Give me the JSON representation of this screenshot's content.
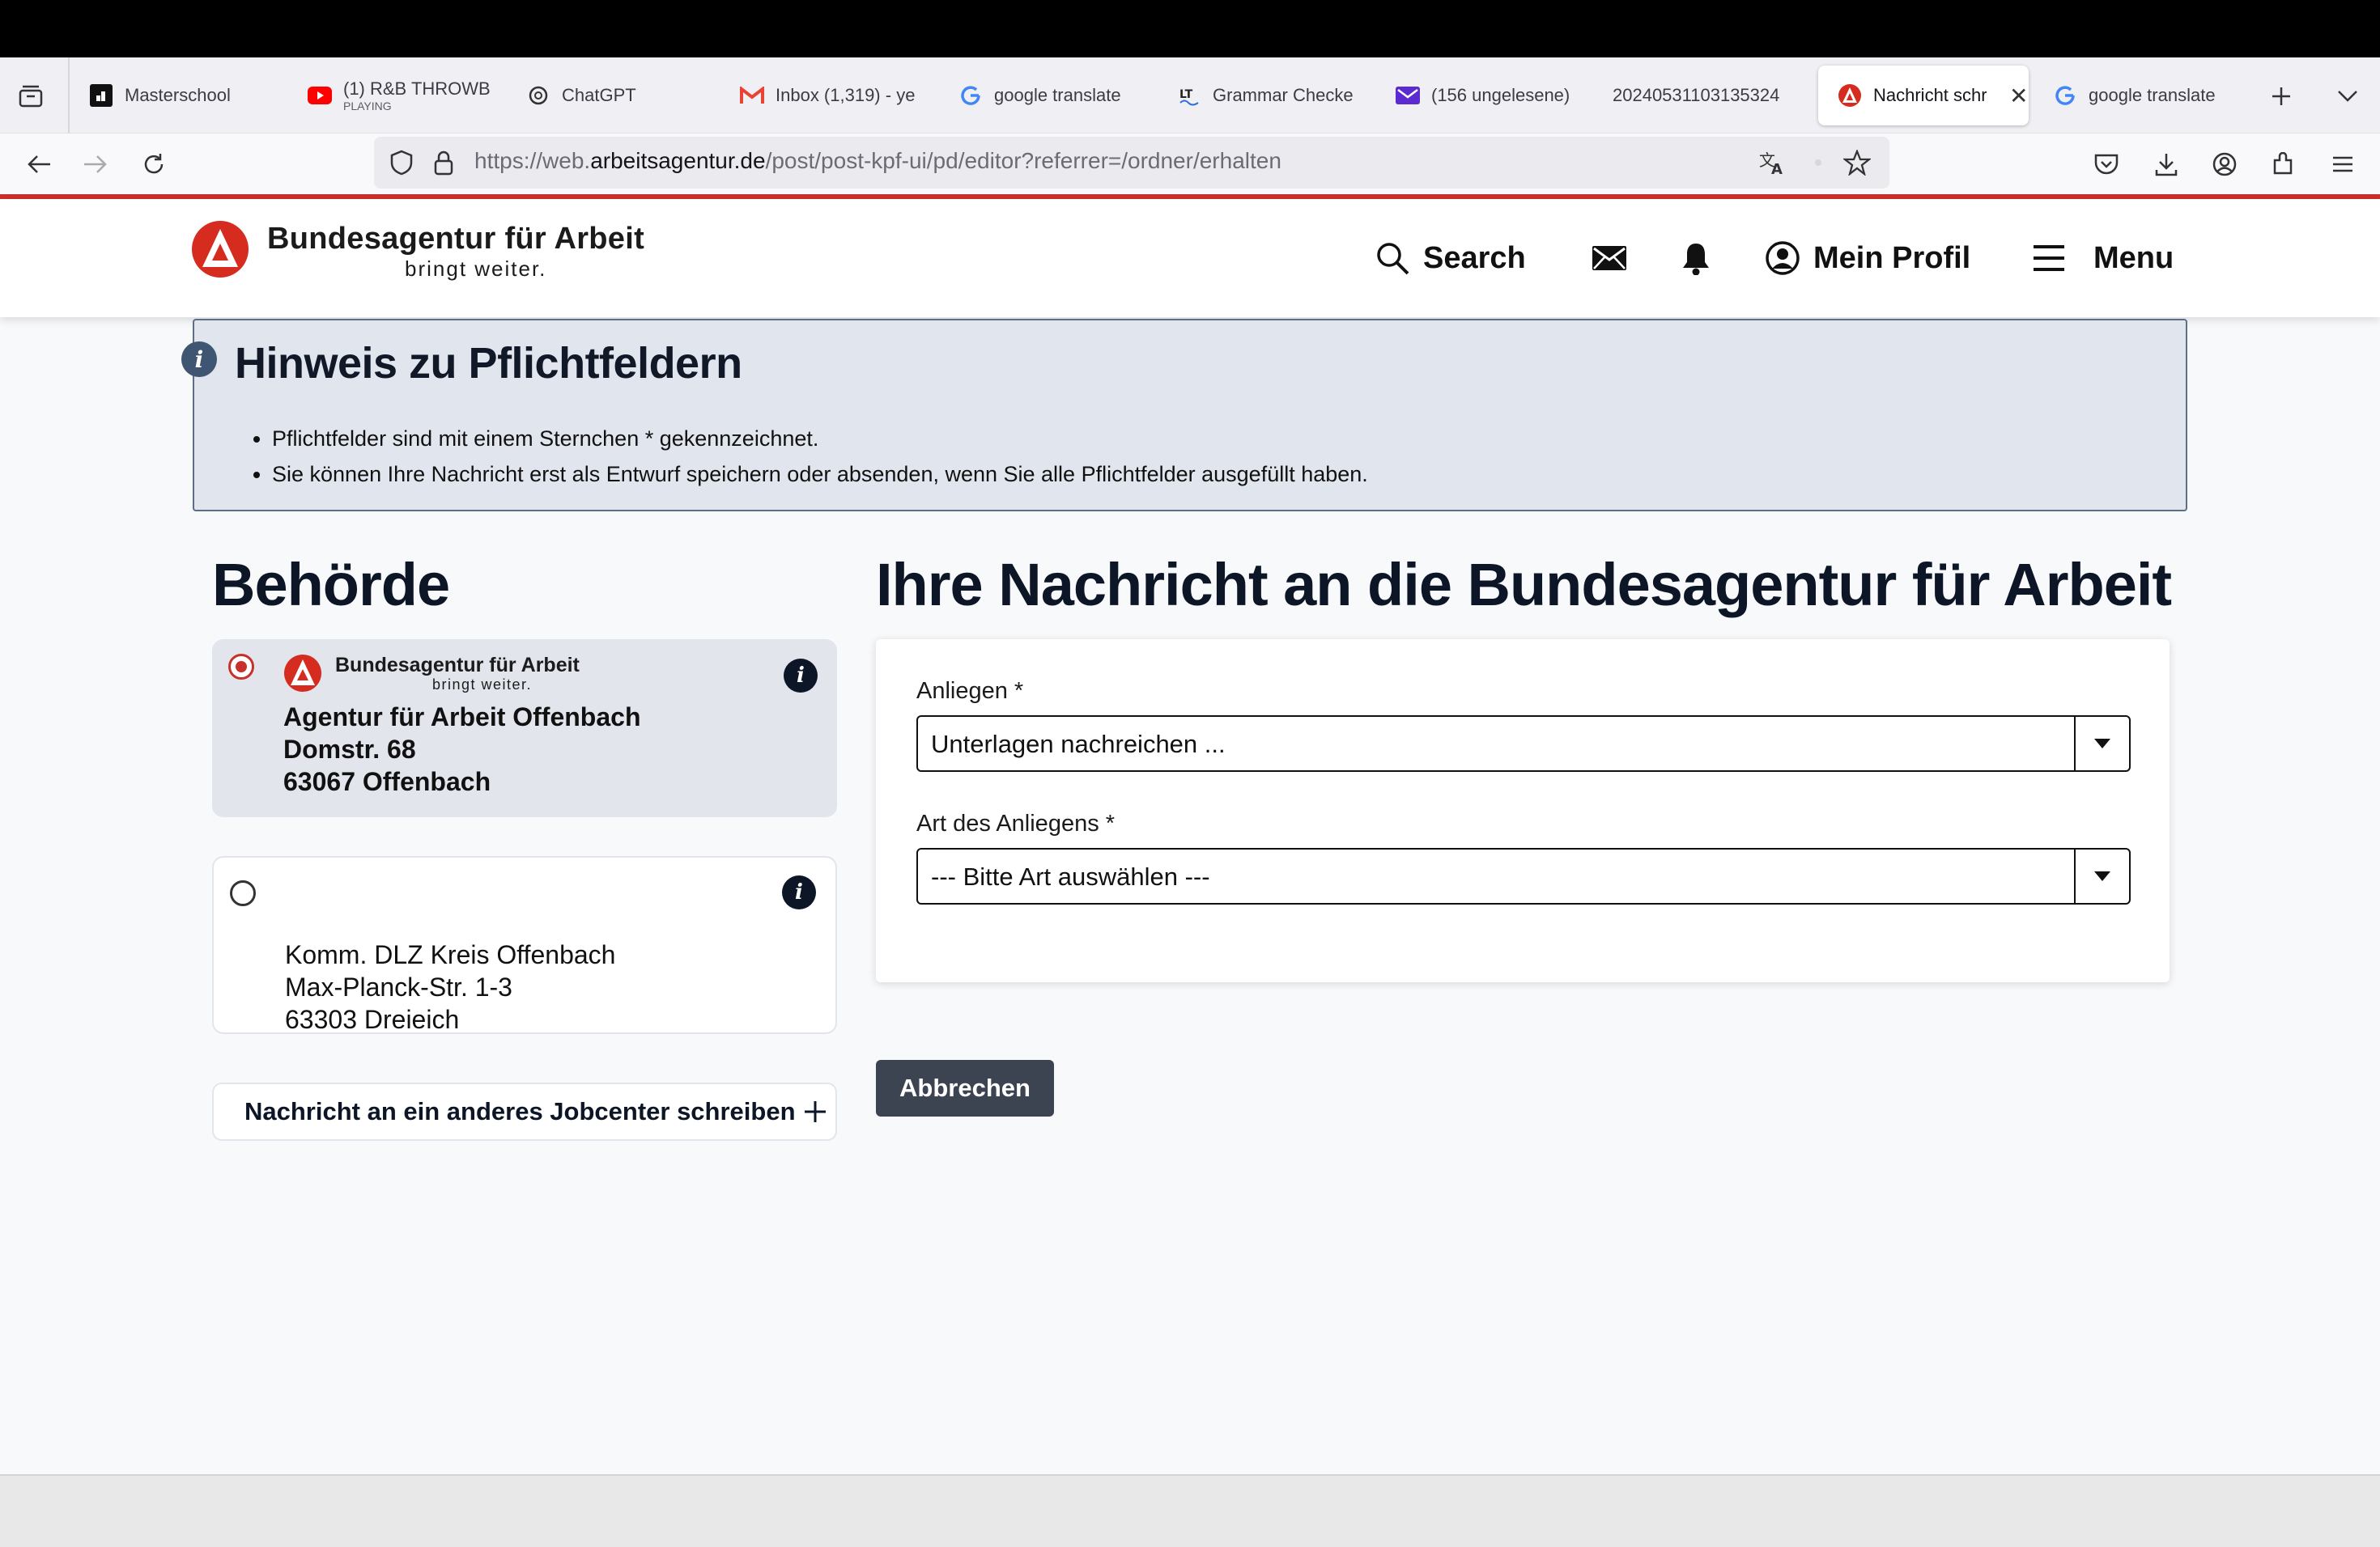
{
  "browser": {
    "tabs": [
      {
        "label": "Masterschool",
        "icon": "masterschool-icon"
      },
      {
        "label": "(1) R&B THROWB",
        "sub": "PLAYING",
        "icon": "youtube-icon"
      },
      {
        "label": "ChatGPT",
        "icon": "chatgpt-icon"
      },
      {
        "label": "Inbox (1,319) - ye",
        "icon": "gmail-icon"
      },
      {
        "label": "google translate",
        "icon": "google-icon"
      },
      {
        "label": "Grammar Checke",
        "icon": "languagetool-icon"
      },
      {
        "label": "(156 ungelesene)",
        "icon": "mail-icon"
      },
      {
        "label": "20240531103135324",
        "icon": ""
      },
      {
        "label": "Nachricht schr",
        "icon": "arbeitsagentur-icon",
        "active": true
      },
      {
        "label": "google translate",
        "icon": "google-icon"
      }
    ],
    "url_prefix": "https://web.",
    "url_domain": "arbeitsagentur.de",
    "url_path": "/post/post-kpf-ui/pd/editor?referrer=/ordner/erhalten"
  },
  "header": {
    "brand_title": "Bundesagentur für Arbeit",
    "brand_sub": "bringt weiter.",
    "search_label": "Search",
    "profile_label": "Mein Profil",
    "menu_label": "Menu"
  },
  "notice": {
    "title": "Hinweis zu Pflichtfeldern",
    "items": [
      "Pflichtfelder sind mit einem Sternchen * gekennzeichnet.",
      "Sie können Ihre Nachricht erst als Entwurf speichern oder absenden, wenn Sie alle Pflichtfelder ausgefüllt haben."
    ]
  },
  "authority": {
    "heading": "Behörde",
    "selected": {
      "brand_title": "Bundesagentur für Arbeit",
      "brand_sub": "bringt weiter.",
      "lines": [
        "Agentur für Arbeit Offenbach",
        "Domstr. 68",
        "63067 Offenbach"
      ]
    },
    "other": {
      "lines": [
        "Komm. DLZ Kreis Offenbach",
        "Max-Planck-Str. 1-3",
        "63303 Dreieich"
      ]
    },
    "other_jobcenter_label": "Nachricht an ein anderes Jobcenter schreiben"
  },
  "message": {
    "heading": "Ihre Nachricht an die Bundesagentur für Arbeit",
    "anliegen_label": "Anliegen *",
    "anliegen_value": "Unterlagen nachreichen ...",
    "art_label": "Art des Anliegens *",
    "art_value": "--- Bitte Art auswählen ---",
    "cancel_label": "Abbrechen"
  },
  "colors": {
    "brand_red": "#c9302c",
    "notice_bg": "#e1e5ed",
    "dark_button": "#3d4451"
  }
}
